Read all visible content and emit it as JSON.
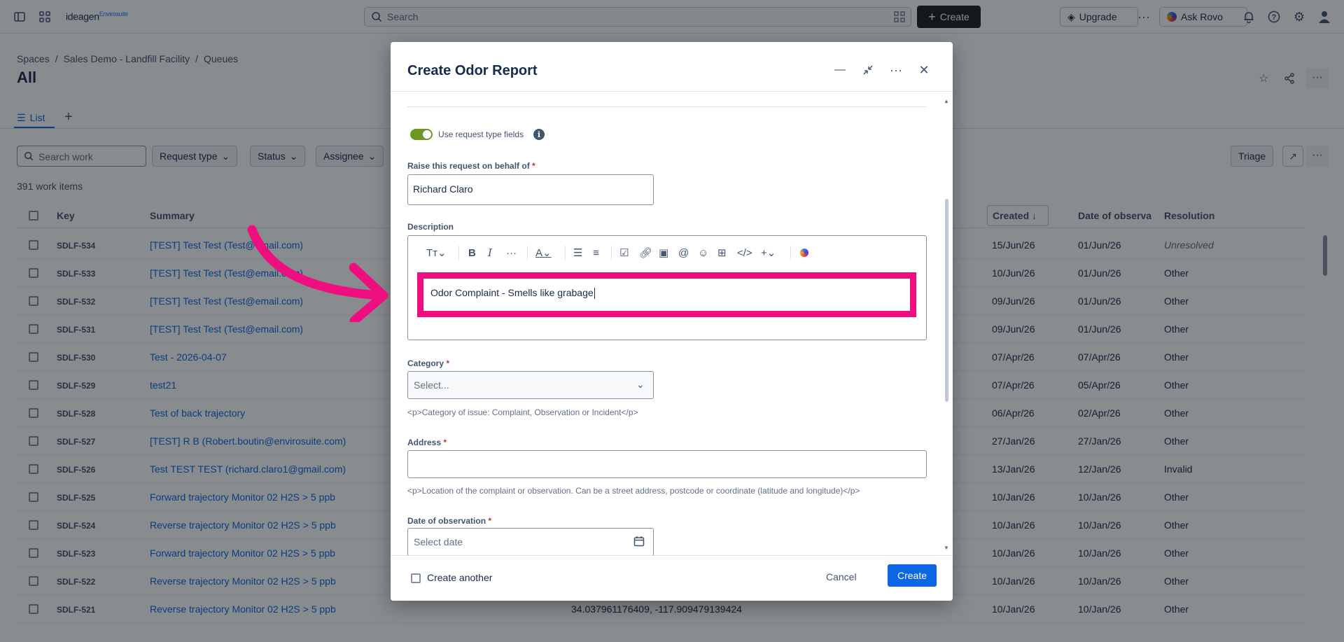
{
  "topnav": {
    "logo": "ideagen",
    "logo_sub": "Envirosuite",
    "search_placeholder": "Search",
    "create_label": "Create",
    "upgrade_label": "Upgrade",
    "ask_rovo_label": "Ask Rovo"
  },
  "breadcrumb": [
    "Spaces",
    "Sales Demo - Landfill Facility",
    "Queues"
  ],
  "page_title": "All",
  "tab_list_label": "List",
  "search_work_placeholder": "Search work",
  "filters": [
    "Request type",
    "Status",
    "Assignee"
  ],
  "triage_label": "Triage",
  "work_count": "391 work items",
  "columns": {
    "key": "Key",
    "summary": "Summary",
    "created": "Created",
    "date_obs": "Date of observa",
    "resolution": "Resolution"
  },
  "rows": [
    {
      "key": "SDLF-534",
      "summary": "[TEST] Test Test (Test@email.com)",
      "created": "15/Jun/26",
      "date_obs": "01/Jun/26",
      "resolution": "Unresolved"
    },
    {
      "key": "SDLF-533",
      "summary": "[TEST] Test Test (Test@email.com)",
      "created": "10/Jun/26",
      "date_obs": "01/Jun/26",
      "resolution": "Other"
    },
    {
      "key": "SDLF-532",
      "summary": "[TEST] Test Test (Test@email.com)",
      "created": "09/Jun/26",
      "date_obs": "01/Jun/26",
      "resolution": "Other"
    },
    {
      "key": "SDLF-531",
      "summary": "[TEST] Test Test (Test@email.com)",
      "created": "09/Jun/26",
      "date_obs": "01/Jun/26",
      "resolution": "Other"
    },
    {
      "key": "SDLF-530",
      "summary": "Test - 2026-04-07",
      "created": "07/Apr/26",
      "date_obs": "07/Apr/26",
      "resolution": "Other"
    },
    {
      "key": "SDLF-529",
      "summary": "test21",
      "created": "07/Apr/26",
      "date_obs": "05/Apr/26",
      "resolution": "Other"
    },
    {
      "key": "SDLF-528",
      "summary": "Test of back trajectory",
      "created": "06/Apr/26",
      "date_obs": "02/Apr/26",
      "resolution": "Other"
    },
    {
      "key": "SDLF-527",
      "summary": "[TEST] R B (Robert.boutin@envirosuite.com)",
      "created": "27/Jan/26",
      "date_obs": "27/Jan/26",
      "resolution": "Other"
    },
    {
      "key": "SDLF-526",
      "summary": "Test TEST TEST (richard.claro1@gmail.com)",
      "created": "13/Jan/26",
      "date_obs": "12/Jan/26",
      "resolution": "Invalid"
    },
    {
      "key": "SDLF-525",
      "summary": "Forward trajectory Monitor 02 H2S > 5 ppb",
      "created": "10/Jan/26",
      "date_obs": "10/Jan/26",
      "resolution": "Other"
    },
    {
      "key": "SDLF-524",
      "summary": "Reverse trajectory Monitor 02 H2S > 5 ppb",
      "created": "10/Jan/26",
      "date_obs": "10/Jan/26",
      "resolution": "Other"
    },
    {
      "key": "SDLF-523",
      "summary": "Forward trajectory Monitor 02 H2S > 5 ppb",
      "created": "10/Jan/26",
      "date_obs": "10/Jan/26",
      "resolution": "Other"
    },
    {
      "key": "SDLF-522",
      "summary": "Reverse trajectory Monitor 02 H2S > 5 ppb",
      "created": "10/Jan/26",
      "date_obs": "10/Jan/26",
      "resolution": "Other"
    },
    {
      "key": "SDLF-521",
      "summary": "Reverse trajectory Monitor 02 H2S > 5 ppb",
      "address": "34.037961176409, -117.909479139424",
      "created": "10/Jan/26",
      "date_obs": "10/Jan/26",
      "resolution": "Other"
    }
  ],
  "modal": {
    "title": "Create Odor Report",
    "toggle_label": "Use request type fields",
    "on_behalf_label": "Raise this request on behalf of",
    "on_behalf_value": "Richard Claro",
    "description_label": "Description",
    "description_value": "Odor Complaint - Smells like grabage",
    "category_label": "Category",
    "category_placeholder": "Select...",
    "category_help": "<p>Category of issue: Complaint, Observation or Incident</p>",
    "address_label": "Address",
    "address_help": "<p>Location of the complaint or observation. Can be a street address, postcode or coordinate (latitude and longitude)</p>",
    "date_label": "Date of observation",
    "date_placeholder": "Select date",
    "required_mark": "*",
    "create_another_label": "Create another",
    "cancel_label": "Cancel",
    "create_label": "Create"
  },
  "colors": {
    "highlight": "#ef0e80",
    "primary": "#0c66e4",
    "toggle_on": "#6a9a23"
  }
}
